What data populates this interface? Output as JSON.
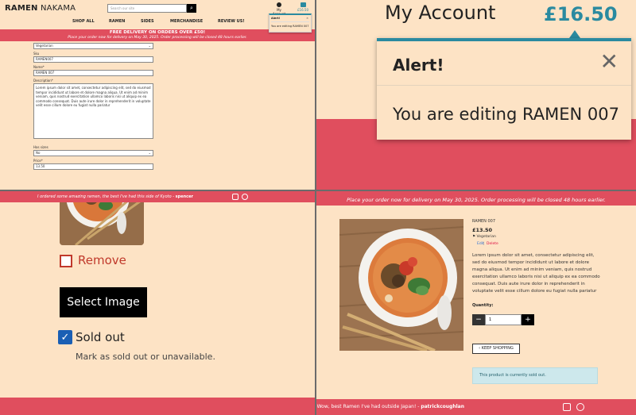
{
  "tl": {
    "logo_bold": "RAMEN",
    "logo_rest": " NAKAMA",
    "search_placeholder": "Search our site",
    "search_icon": "search-icon",
    "nav": [
      "SHOP ALL",
      "RAMEN",
      "SIDES",
      "MERCHANDISE",
      "REVIEW US!"
    ],
    "account_label": "My Account",
    "bag_amount": "£16.50",
    "mini_alert_title": "Alert!",
    "mini_alert_body": "You are editing RAMEN 007",
    "banner_title": "FREE DELIVERY ON ORDERS OVER £50!",
    "banner_sub": "Place your order now for delivery on May 30, 2025. Order processing will be closed 48 hours earlier.",
    "fields": {
      "category_value": "Vegetarian",
      "sku_label": "Sku",
      "sku_value": "RAMEN007",
      "name_label": "Name*",
      "name_value": "RAMEN 007",
      "description_label": "Description*",
      "description_value": "Lorem ipsum dolor sit amet, consectetur adipiscing elit, sed do eiusmod tempor incididunt ut labore et dolore magna aliqua. Ut enim ad minim veniam, quis nostrud exercitation ullamco laboris nisi ut aliquip ex ea commodo consequat. Duis aute irure dolor in reprehenderit in voluptate velit esse cillum dolore eu fugiat nulla pariatur",
      "has_sizes_label": "Has sizes",
      "has_sizes_value": "No",
      "price_label": "Price*",
      "price_value": "13.50"
    }
  },
  "tr": {
    "title": "My Account",
    "total": "£16.50",
    "alert_title": "Alert!",
    "alert_close": "✕",
    "alert_body": "You are editing RAMEN 007"
  },
  "bl": {
    "topbar_text": "I ordered some amazing ramen, the best I've had this side of Kyoto - ",
    "topbar_author": "spencer",
    "remove_label": "Remove",
    "select_image_label": "Select Image",
    "sold_out_label": "Sold out",
    "sold_out_hint": "Mark as sold out or unavailable.",
    "social_icons": [
      "instagram-icon",
      "whatsapp-icon"
    ]
  },
  "br": {
    "topbar_text": "Place your order now for delivery on May 30, 2025. Order processing will be closed 48 hours earlier.",
    "product_name": "RAMEN 007",
    "product_price": "£13.50",
    "product_category": "Vegetarian",
    "edit_label": "Edit",
    "delete_label": "Delete",
    "description": "Lorem ipsum dolor sit amet, consectetur adipiscing elit, sed do eiusmod tempor incididunt ut labore et dolore magna aliqua. Ut enim ad minim veniam, quis nostrud exercitation ullamco laboris nisi ut aliquip ex ea commodo consequat. Duis aute irure dolor in reprehenderit in voluptate velit esse cillum dolore eu fugiat nulla pariatur",
    "quantity_label": "Quantity:",
    "quantity_value": "1",
    "minus_label": "−",
    "plus_label": "+",
    "keep_shopping_label": "‹  KEEP SHOPPING",
    "sold_out_notice": "This product is currently sold out.",
    "footer_text": "Wow, best Ramen I've had outside Japan! - ",
    "footer_author": "patrickcoughlan",
    "social_icons": [
      "instagram-icon",
      "whatsapp-icon"
    ]
  },
  "colors": {
    "brand_red": "#e04e5e",
    "background": "#fde3c5",
    "accent_teal": "#2a8aa0",
    "button_black": "#000000"
  }
}
